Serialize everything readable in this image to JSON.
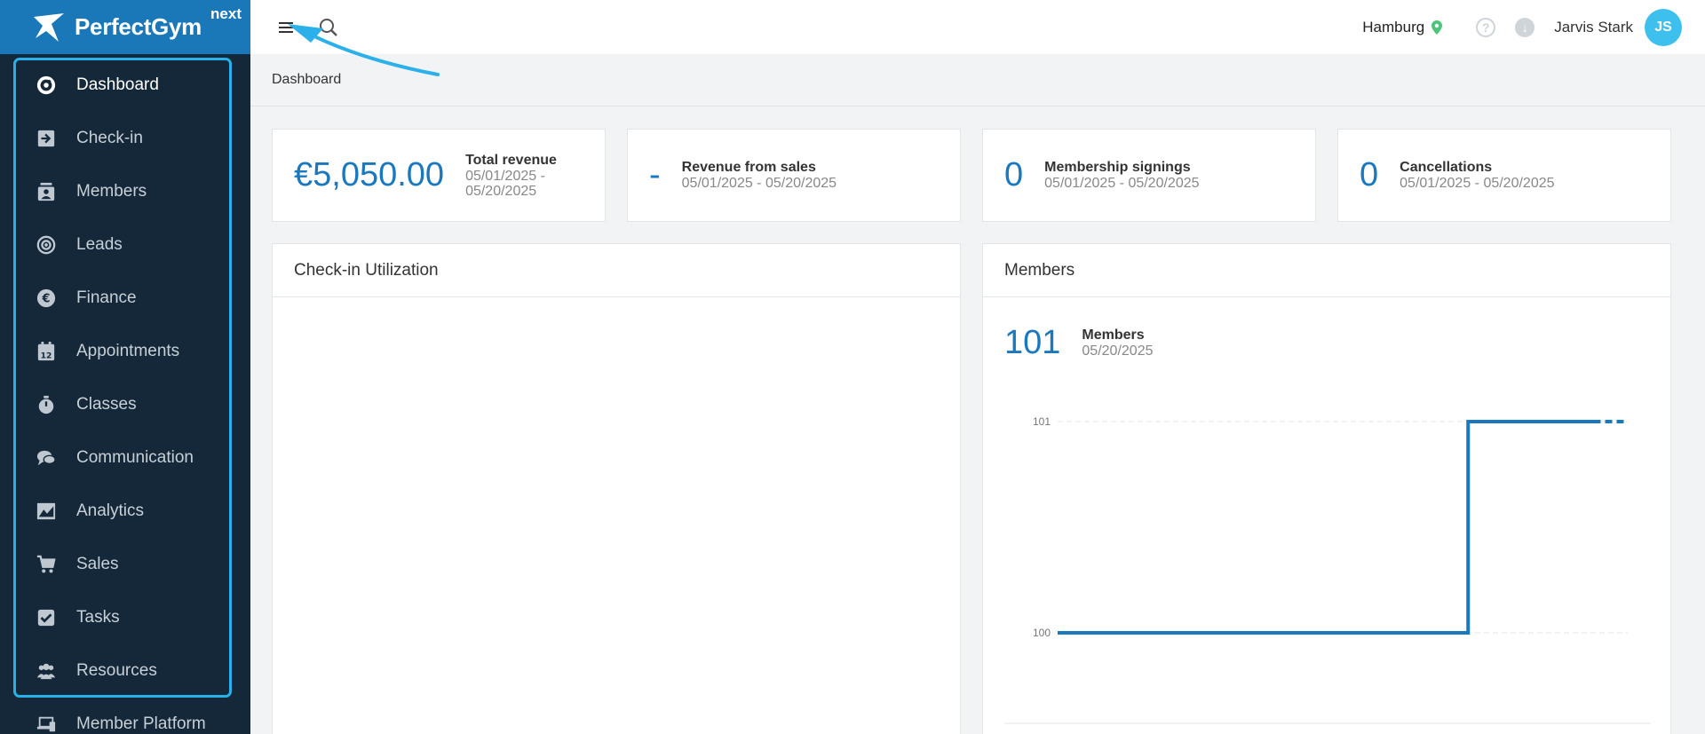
{
  "brand": {
    "name": "PerfectGym",
    "suffix": "next"
  },
  "sidebar": {
    "items": [
      {
        "label": "Dashboard",
        "icon": "dashboard-icon",
        "active": true
      },
      {
        "label": "Check-in",
        "icon": "check-in-icon"
      },
      {
        "label": "Members",
        "icon": "members-icon"
      },
      {
        "label": "Leads",
        "icon": "leads-icon"
      },
      {
        "label": "Finance",
        "icon": "finance-icon"
      },
      {
        "label": "Appointments",
        "icon": "appointments-icon"
      },
      {
        "label": "Classes",
        "icon": "classes-icon"
      },
      {
        "label": "Communication",
        "icon": "communication-icon"
      },
      {
        "label": "Analytics",
        "icon": "analytics-icon"
      },
      {
        "label": "Sales",
        "icon": "sales-icon"
      },
      {
        "label": "Tasks",
        "icon": "tasks-icon"
      },
      {
        "label": "Resources",
        "icon": "resources-icon"
      },
      {
        "label": "Member Platform",
        "icon": "member-platform-icon"
      }
    ]
  },
  "topbar": {
    "location": "Hamburg",
    "user_name": "Jarvis Stark",
    "user_initials": "JS",
    "help_glyph": "?",
    "download_glyph": "↓"
  },
  "breadcrumb": "Dashboard",
  "kpis": [
    {
      "value": "€5,050.00",
      "title": "Total revenue",
      "sub1": "05/01/2025 -",
      "sub2": "05/20/2025"
    },
    {
      "value": "-",
      "title": "Revenue from sales",
      "sub1": "05/01/2025 - 05/20/2025",
      "sub2": ""
    },
    {
      "value": "0",
      "title": "Membership signings",
      "sub1": "05/01/2025 - 05/20/2025",
      "sub2": ""
    },
    {
      "value": "0",
      "title": "Cancellations",
      "sub1": "05/01/2025 - 05/20/2025",
      "sub2": ""
    }
  ],
  "checkin_panel": {
    "title": "Check-in Utilization"
  },
  "members_panel": {
    "title": "Members",
    "count": "101",
    "label": "Members",
    "date": "05/20/2025"
  },
  "colors": {
    "accent": "#1b78bd",
    "sidebar": "#14283a",
    "logo_bg": "#1a78b8",
    "highlight": "#27b0ea"
  },
  "chart_data": {
    "type": "line",
    "title": "",
    "xlabel": "",
    "ylabel": "",
    "y_ticks": [
      "101",
      "100"
    ],
    "ylim": [
      100,
      101
    ],
    "series": [
      {
        "points": [
          [
            0,
            100
          ],
          [
            0.72,
            100
          ],
          [
            0.72,
            101
          ],
          [
            0.94,
            101
          ]
        ],
        "style": "solid"
      },
      {
        "points": [
          [
            0.94,
            101
          ],
          [
            1.0,
            101
          ]
        ],
        "style": "dashed"
      }
    ]
  }
}
